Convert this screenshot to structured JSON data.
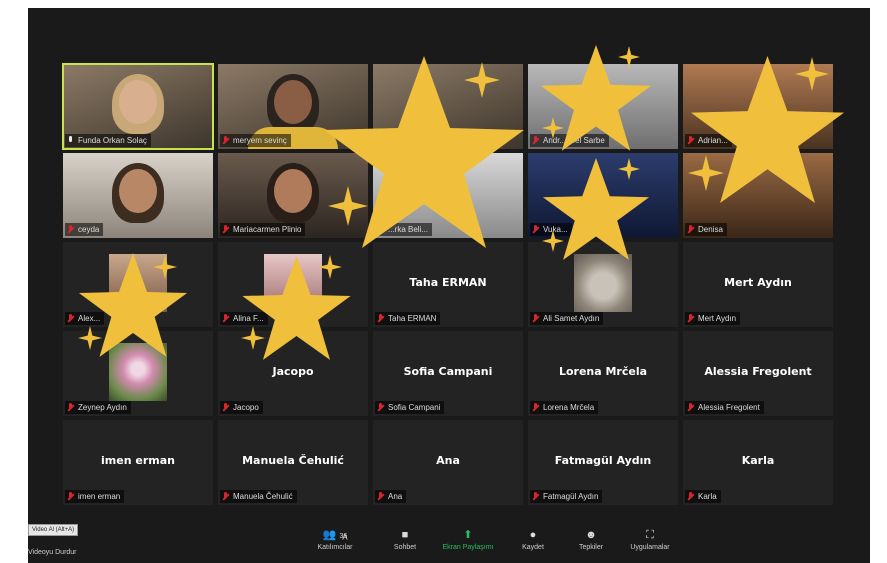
{
  "tooltip": "Video Al (Alt+A)",
  "stop_video_label": "Videoyu Durdur",
  "toolbar": {
    "participants_label": "Katılımcılar",
    "participants_count": "36",
    "chat_label": "Sohbet",
    "share_label": "Ekran Paylaşımı",
    "record_label": "Kaydet",
    "reactions_label": "Tepkiler",
    "apps_label": "Uygulamalar"
  },
  "tiles": [
    {
      "name": "Funda Orkan Solaç",
      "big": ""
    },
    {
      "name": "meryem sevinç",
      "big": ""
    },
    {
      "name": "",
      "big": ""
    },
    {
      "name": "Andr... ...el Sarbe",
      "big": ""
    },
    {
      "name": "Adrian...",
      "big": ""
    },
    {
      "name": "ceyda",
      "big": ""
    },
    {
      "name": "Mariacarmen Plinio",
      "big": ""
    },
    {
      "name": "...rka Beli...",
      "big": ""
    },
    {
      "name": "Vuka...",
      "big": ""
    },
    {
      "name": "Denisa",
      "big": ""
    },
    {
      "name": "Alex...",
      "big": ""
    },
    {
      "name": "Alina F...",
      "big": ""
    },
    {
      "name": "Taha ERMAN",
      "big": "Taha ERMAN"
    },
    {
      "name": "Ali Samet Aydın",
      "big": ""
    },
    {
      "name": "Mert Aydın",
      "big": "Mert Aydın"
    },
    {
      "name": "Zeynep Aydın",
      "big": ""
    },
    {
      "name": "Jacopo",
      "big": "Jacopo"
    },
    {
      "name": "Sofia Campani",
      "big": "Sofia Campani"
    },
    {
      "name": "Lorena Mrčela",
      "big": "Lorena Mrčela"
    },
    {
      "name": "Alessia Fregolent",
      "big": "Alessia Fregolent"
    },
    {
      "name": "imen erman",
      "big": "imen erman"
    },
    {
      "name": "Manuela Čehulić",
      "big": "Manuela Čehulić"
    },
    {
      "name": "Ana",
      "big": "Ana"
    },
    {
      "name": "Fatmagül Aydın",
      "big": "Fatmagül Aydın"
    },
    {
      "name": "Karla",
      "big": "Karla"
    }
  ],
  "colors": {
    "star": "#f0c03c",
    "active_outline": "#c9e24a",
    "muted_mic": "#d7262e",
    "share_green": "#2bbd5a"
  }
}
